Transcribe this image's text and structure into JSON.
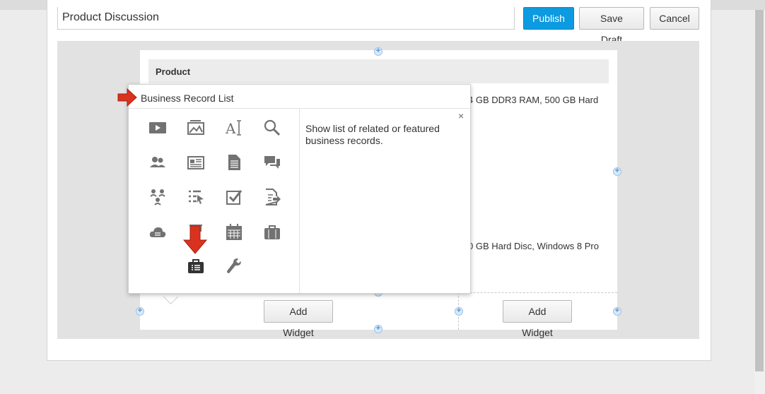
{
  "header": {
    "title_value": "Product Discussion",
    "publish_label": "Publish",
    "save_draft_label": "Save Draft",
    "cancel_label": "Cancel"
  },
  "table": {
    "column_header": "Product",
    "row1_text": "4 GB DDR3 RAM, 500 GB Hard",
    "row2_text": "0 GB Hard Disc, Windows 8 Pro"
  },
  "popover": {
    "title": "Business Record List",
    "description": "Show list of related or featured business records.",
    "close_glyph": "×",
    "icons": [
      "video-icon",
      "picture-icon",
      "text-icon",
      "search-icon",
      "people-icon",
      "newspaper-icon",
      "document-icon",
      "chat-icon",
      "org-chart-icon",
      "list-select-icon",
      "checkbox-icon",
      "export-document-icon",
      "cloud-icon",
      "ribbon-icon",
      "calendar-icon",
      "briefcase-icon",
      "business-record-list-icon",
      "wrench-icon"
    ]
  },
  "buttons": {
    "add_widget_label": "Add Widget"
  },
  "plus_glyph": "+",
  "colors": {
    "accent": "#0c9ae0",
    "arrow": "#d9321f"
  }
}
